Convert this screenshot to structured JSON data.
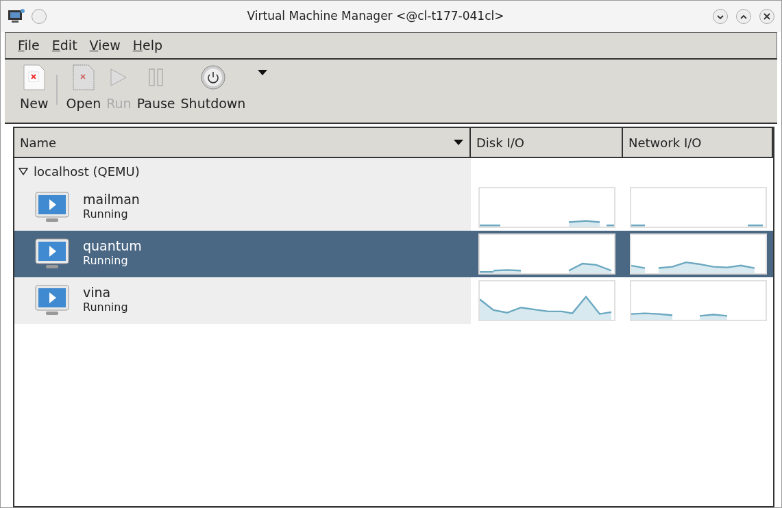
{
  "window": {
    "title": "Virtual Machine Manager <@cl-t177-041cl>"
  },
  "menu": [
    "File",
    "Edit",
    "View",
    "Help"
  ],
  "toolbar": [
    {
      "label": "New",
      "kind": "new",
      "disabled": false
    },
    {
      "label": "Open",
      "kind": "open",
      "disabled": false
    },
    {
      "label": "Run",
      "kind": "run",
      "disabled": true
    },
    {
      "label": "Pause",
      "kind": "pause",
      "disabled": false
    },
    {
      "label": "Shutdown",
      "kind": "shutdown",
      "disabled": false
    }
  ],
  "table": {
    "columns": [
      "Name",
      "Disk I/O",
      "Network I/O"
    ],
    "host": {
      "label": "localhost (QEMU)",
      "expanded": true
    },
    "rows": [
      {
        "name": "mailman",
        "status": "Running",
        "selected": false
      },
      {
        "name": "quantum",
        "status": "Running",
        "selected": true
      },
      {
        "name": "vina",
        "status": "Running",
        "selected": false
      }
    ]
  }
}
